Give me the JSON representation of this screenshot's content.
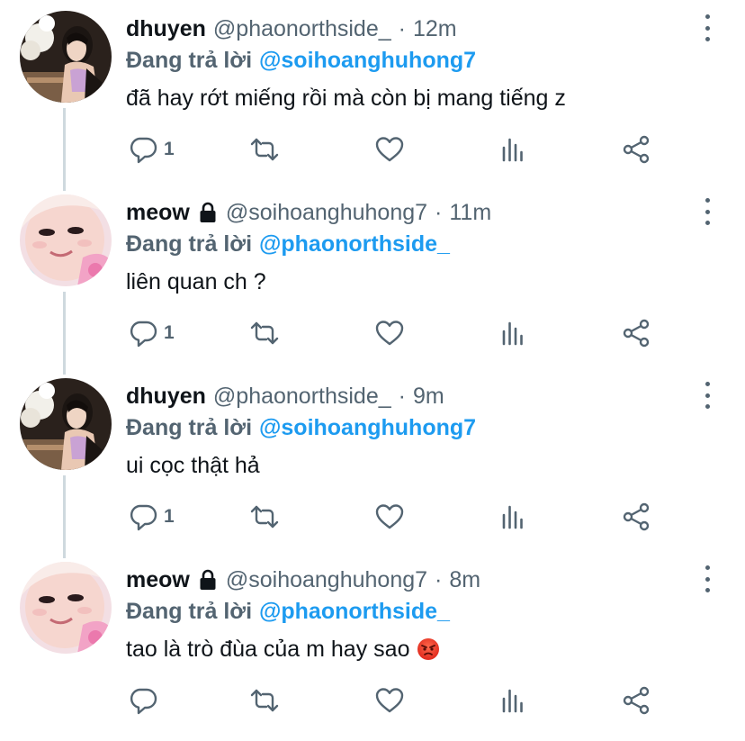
{
  "colors": {
    "name": "#0f1419",
    "muted": "#536471",
    "link": "#1d9bf0",
    "thread_line": "#cfd9de"
  },
  "icons": {
    "reply": "reply-icon",
    "retweet": "retweet-icon",
    "like": "heart-icon",
    "stats": "stats-icon",
    "share": "share-icon",
    "more": "more-options-icon",
    "lock": "lock-icon"
  },
  "tweets": [
    {
      "name": "dhuyen",
      "handle": "@phaonorthside_",
      "separator": "·",
      "time": "12m",
      "reply_prefix": "Đang trả lời",
      "reply_to": "@soihoanghuhong7",
      "text": "đã hay rớt miếng rồi mà còn bị mang tiếng z",
      "reply_count": "1"
    },
    {
      "name": "meow",
      "handle": "@soihoanghuhong7",
      "separator": "·",
      "time": "11m",
      "reply_prefix": "Đang trả lời",
      "reply_to": "@phaonorthside_",
      "text": "liên quan ch ?",
      "reply_count": "1"
    },
    {
      "name": "dhuyen",
      "handle": "@phaonorthside_",
      "separator": "·",
      "time": "9m",
      "reply_prefix": "Đang trả lời",
      "reply_to": "@soihoanghuhong7",
      "text": "ui cọc thật hả",
      "reply_count": "1"
    },
    {
      "name": "meow",
      "handle": "@soihoanghuhong7",
      "separator": "·",
      "time": "8m",
      "reply_prefix": "Đang trả lời",
      "reply_to": "@phaonorthside_",
      "text": "tao là trò đùa của m hay sao",
      "emoji": "angry-face-emoji",
      "reply_count": ""
    }
  ]
}
